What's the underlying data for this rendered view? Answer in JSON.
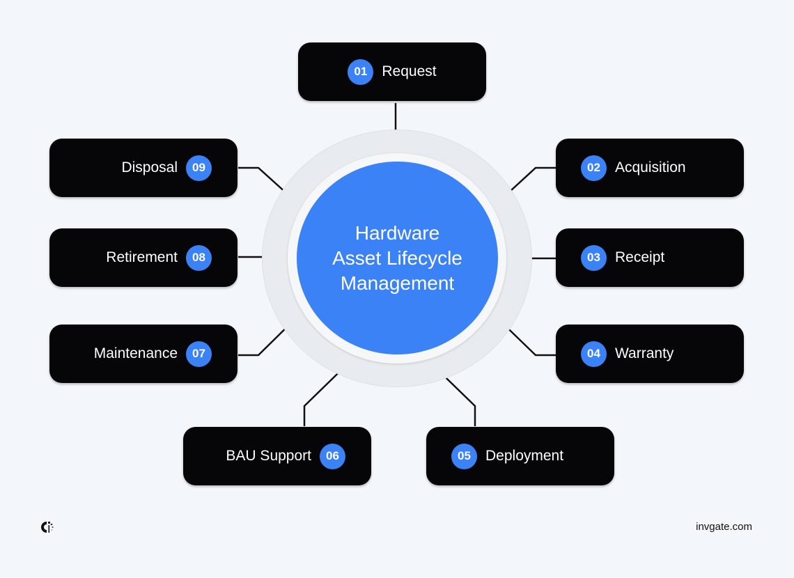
{
  "hub": {
    "title": "Hardware\nAsset Lifecycle\nManagement"
  },
  "colors": {
    "background": "#f3f6fa",
    "accent": "#3b82f6",
    "node": "#060608",
    "ring": "#e8ebef"
  },
  "steps": [
    {
      "number": "01",
      "label": "Request"
    },
    {
      "number": "02",
      "label": "Acquisition"
    },
    {
      "number": "03",
      "label": "Receipt"
    },
    {
      "number": "04",
      "label": "Warranty"
    },
    {
      "number": "05",
      "label": "Deployment"
    },
    {
      "number": "06",
      "label": "BAU Support"
    },
    {
      "number": "07",
      "label": "Maintenance"
    },
    {
      "number": "08",
      "label": "Retirement"
    },
    {
      "number": "09",
      "label": "Disposal"
    }
  ],
  "footer": {
    "logo": "invgate-logo-icon",
    "url": "invgate.com"
  }
}
